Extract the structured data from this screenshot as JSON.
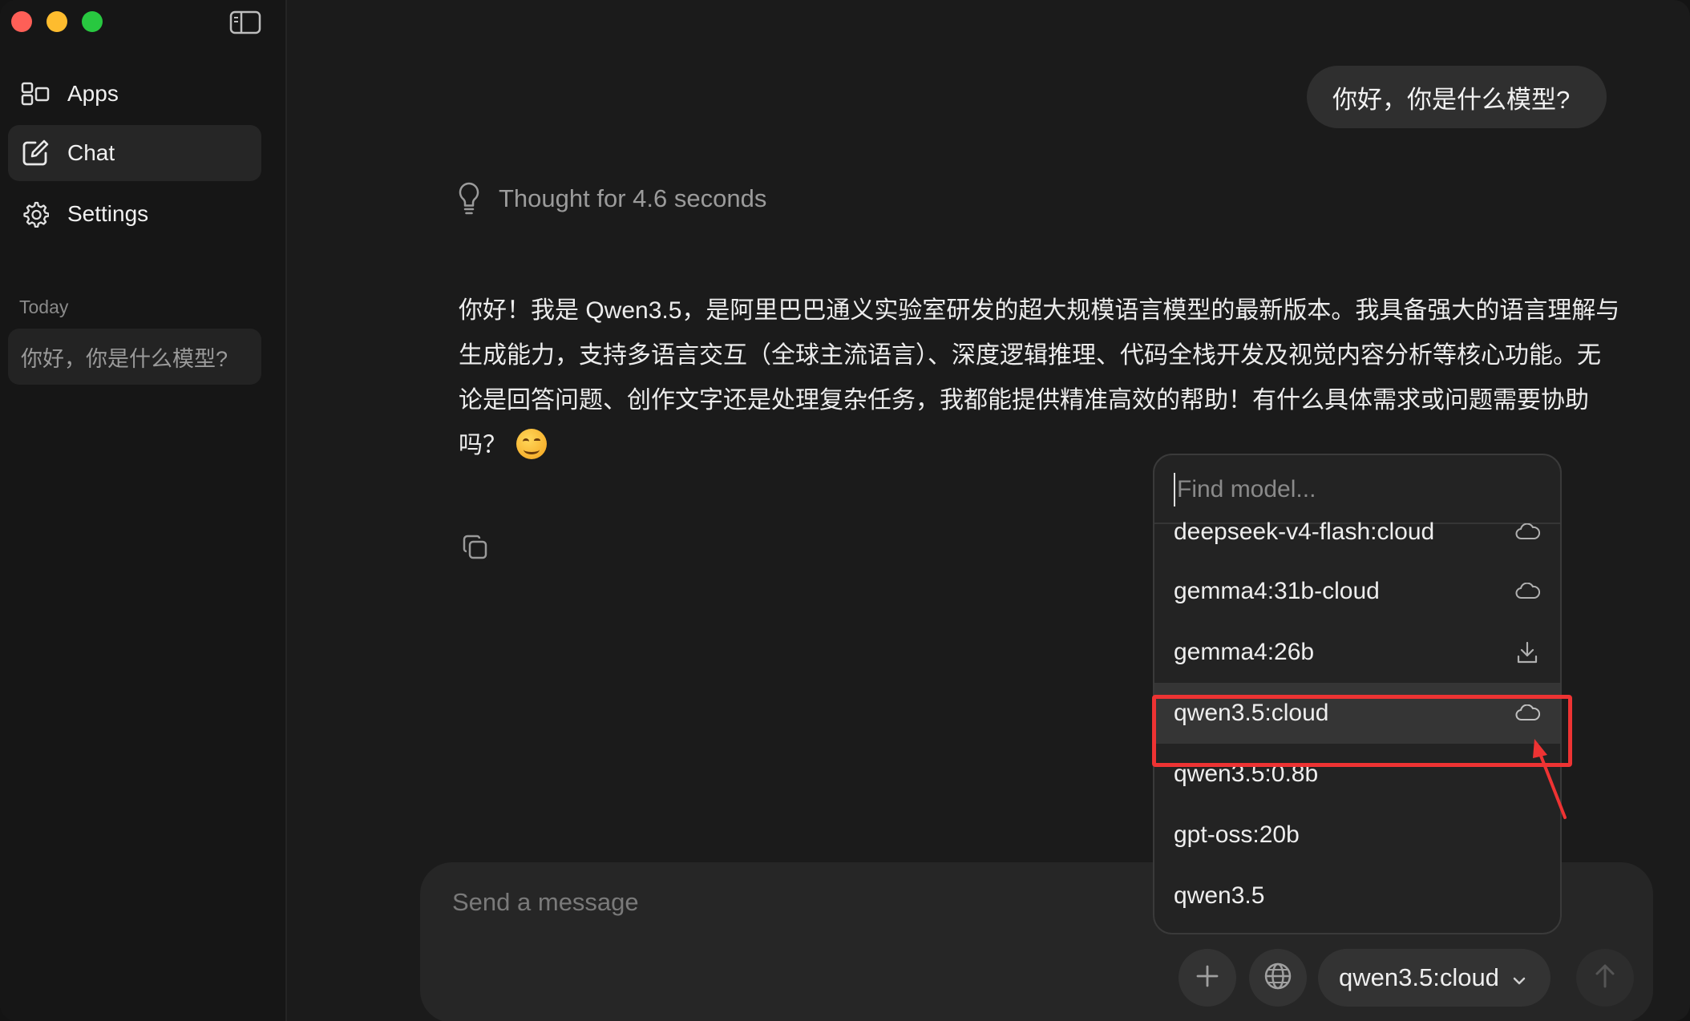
{
  "sidebar": {
    "nav": [
      {
        "label": "Apps",
        "icon": "apps-icon"
      },
      {
        "label": "Chat",
        "icon": "new-chat-icon",
        "active": true
      },
      {
        "label": "Settings",
        "icon": "gear-icon"
      }
    ],
    "section_label": "Today",
    "history": [
      {
        "label": "你好，你是什么模型?"
      }
    ]
  },
  "conversation": {
    "user_message": "你好，你是什么模型?",
    "thought_label": "Thought for 4.6 seconds",
    "answer": "你好！我是 Qwen3.5，是阿里巴巴通义实验室研发的超大规模语言模型的最新版本。我具备强大的语言理解与生成能力，支持多语言交互（全球主流语言）、深度逻辑推理、代码全栈开发及视觉内容分析等核心功能。无论是回答问题、创作文字还是处理复杂任务，我都能提供精准高效的帮助！有什么具体需求或问题需要协助吗？"
  },
  "composer": {
    "placeholder": "Send a message",
    "selected_model": "qwen3.5:cloud"
  },
  "model_dropdown": {
    "search_placeholder": "Find model...",
    "items": [
      {
        "name": "deepseek-v4-flash:cloud",
        "icon": "cloud-icon"
      },
      {
        "name": "gemma4:31b-cloud",
        "icon": "cloud-icon"
      },
      {
        "name": "gemma4:26b",
        "icon": "download-icon"
      },
      {
        "name": "qwen3.5:cloud",
        "icon": "cloud-icon",
        "selected": true
      },
      {
        "name": "qwen3.5:0.8b",
        "icon": ""
      },
      {
        "name": "gpt-oss:20b",
        "icon": ""
      },
      {
        "name": "qwen3.5",
        "icon": ""
      }
    ]
  },
  "colors": {
    "window_bg": "#1b1b1b",
    "sidebar_bg": "#161616",
    "bubble_bg": "#2f2f2f",
    "annotation_red": "#ee3333",
    "traffic_red": "#fe5f57",
    "traffic_yellow": "#febc2e",
    "traffic_green": "#28c840"
  }
}
